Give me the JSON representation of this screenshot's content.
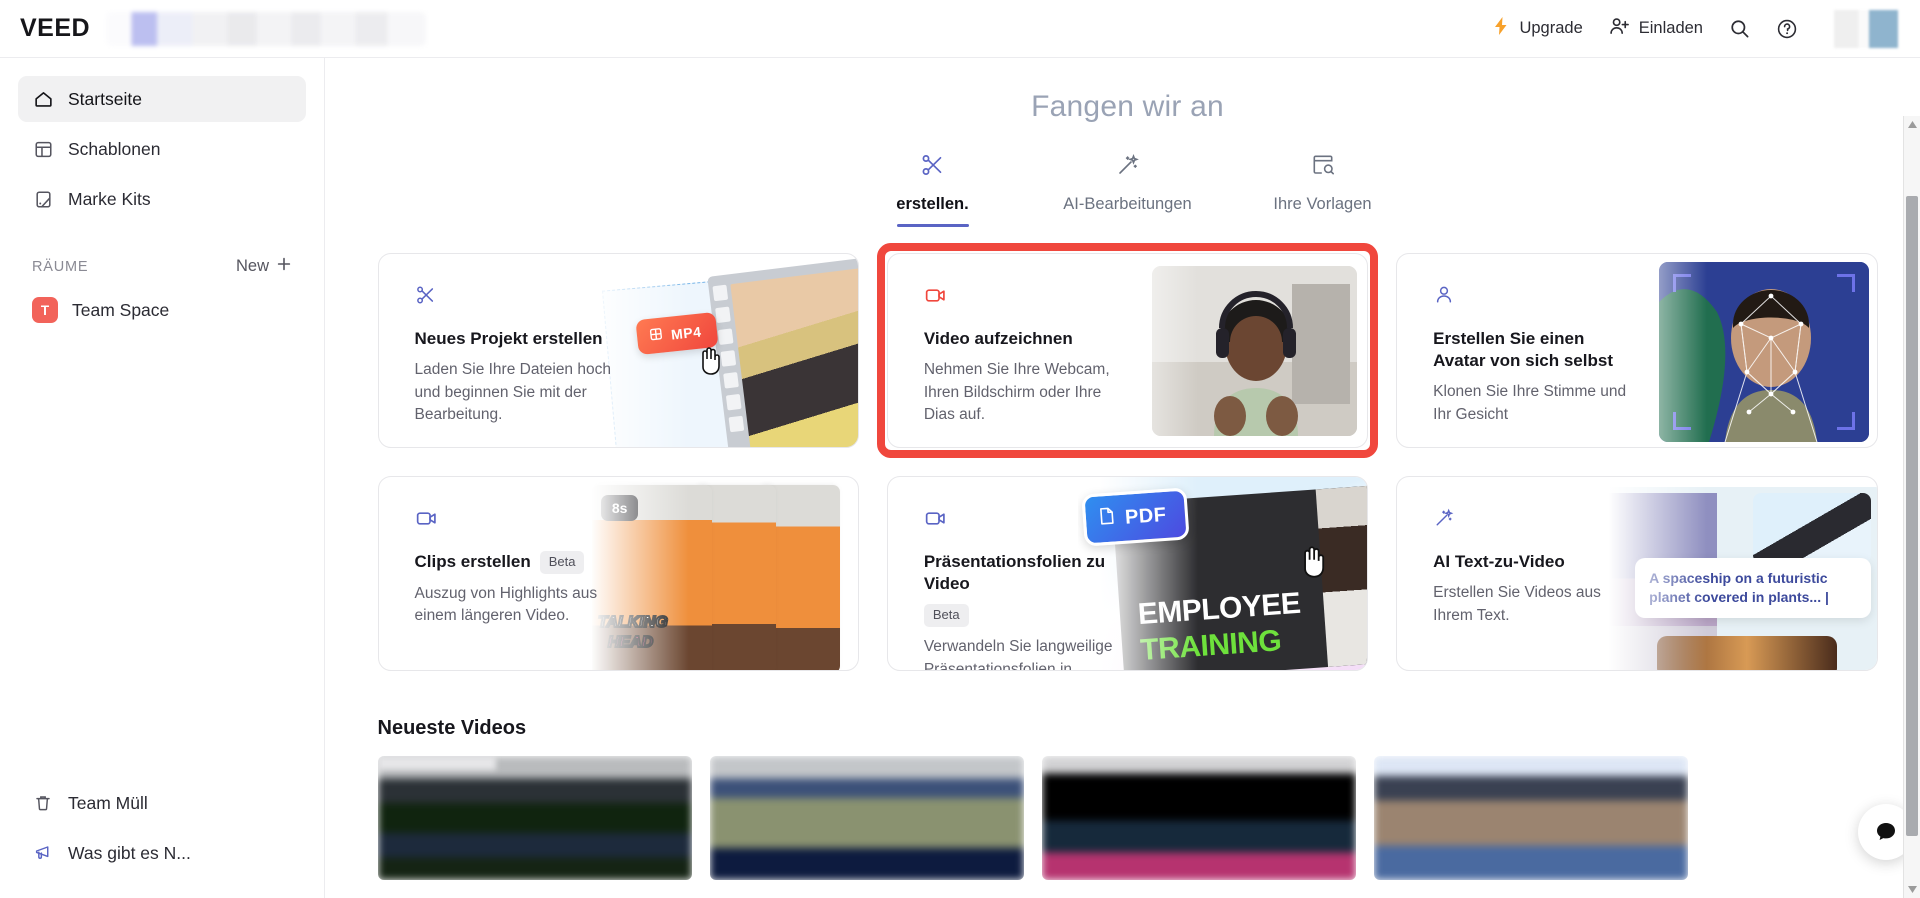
{
  "topbar": {
    "logo": "VEED",
    "upgrade_label": "Upgrade",
    "invite_label": "Einladen",
    "search_icon": "search-icon",
    "help_icon": "help-circle-icon"
  },
  "sidebar": {
    "items": [
      {
        "label": "Startseite",
        "icon": "home-icon",
        "active": true
      },
      {
        "label": "Schablonen",
        "icon": "templates-icon",
        "active": false
      },
      {
        "label": "Marke Kits",
        "icon": "brand-kit-icon",
        "active": false
      }
    ],
    "spaces_heading": "RÄUME",
    "new_label": "New",
    "space": {
      "badge": "T",
      "name": "Team Space",
      "badge_color": "#f2635a"
    },
    "bottom_items": [
      {
        "label": "Team Müll",
        "icon": "trash-icon"
      },
      {
        "label": "Was gibt es N...",
        "icon": "megaphone-icon"
      }
    ]
  },
  "main": {
    "title": "Fangen wir an",
    "tabs": [
      {
        "label": "erstellen.",
        "icon": "scissors-icon",
        "active": true
      },
      {
        "label": "AI-Bearbeitungen",
        "icon": "magic-wand-icon",
        "active": false
      },
      {
        "label": "Ihre Vorlagen",
        "icon": "template-search-icon",
        "active": false
      }
    ],
    "cards": [
      {
        "title": "Neues Projekt erstellen",
        "desc": "Laden Sie Ihre Dateien hoch und beginnen Sie mit der Bearbeitung.",
        "icon": "scissors-icon",
        "icon_color": "#5a64c4",
        "badge": "",
        "art_badge": "MP4",
        "highlighted": false
      },
      {
        "title": "Video aufzeichnen",
        "desc": "Nehmen Sie Ihre Webcam, Ihren Bildschirm oder Ihre Dias auf.",
        "icon": "video-camera-icon",
        "icon_color": "#f0473d",
        "badge": "",
        "art_badge": "",
        "highlighted": true
      },
      {
        "title": "Erstellen Sie einen Avatar von sich selbst",
        "desc": "Klonen Sie Ihre Stimme und Ihr Gesicht",
        "icon": "person-icon",
        "icon_color": "#5a64c4",
        "badge": "",
        "art_badge": "",
        "highlighted": false
      },
      {
        "title": "Clips erstellen",
        "desc": "Auszug von Highlights aus einem längeren Video.",
        "icon": "video-camera-icon",
        "icon_color": "#5a64c4",
        "badge": "Beta",
        "art_badge": "8s",
        "art_text_1": "TALKING",
        "art_text_2": "HEAD",
        "highlighted": false
      },
      {
        "title": "Präsentationsfolien zu Video",
        "desc": "Verwandeln Sie langweilige Präsentationsfolien in überzeugende Videos.",
        "icon": "video-camera-icon",
        "icon_color": "#5a64c4",
        "badge": "Beta",
        "art_badge": "PDF",
        "art_text_1": "EMPLOYEE",
        "art_text_2": "TRAINING",
        "highlighted": false
      },
      {
        "title": "AI Text-zu-Video",
        "desc": "Erstellen Sie Videos aus Ihrem Text.",
        "icon": "magic-wand-icon",
        "icon_color": "#5a64c4",
        "badge": "",
        "art_prompt": "A spaceship on a futuristic planet covered in plants... |",
        "highlighted": false
      }
    ],
    "latest_videos_title": "Neueste Videos",
    "latest_videos_count": 4
  },
  "highlight_color": "#f0473d",
  "accent_color": "#5a64c4"
}
